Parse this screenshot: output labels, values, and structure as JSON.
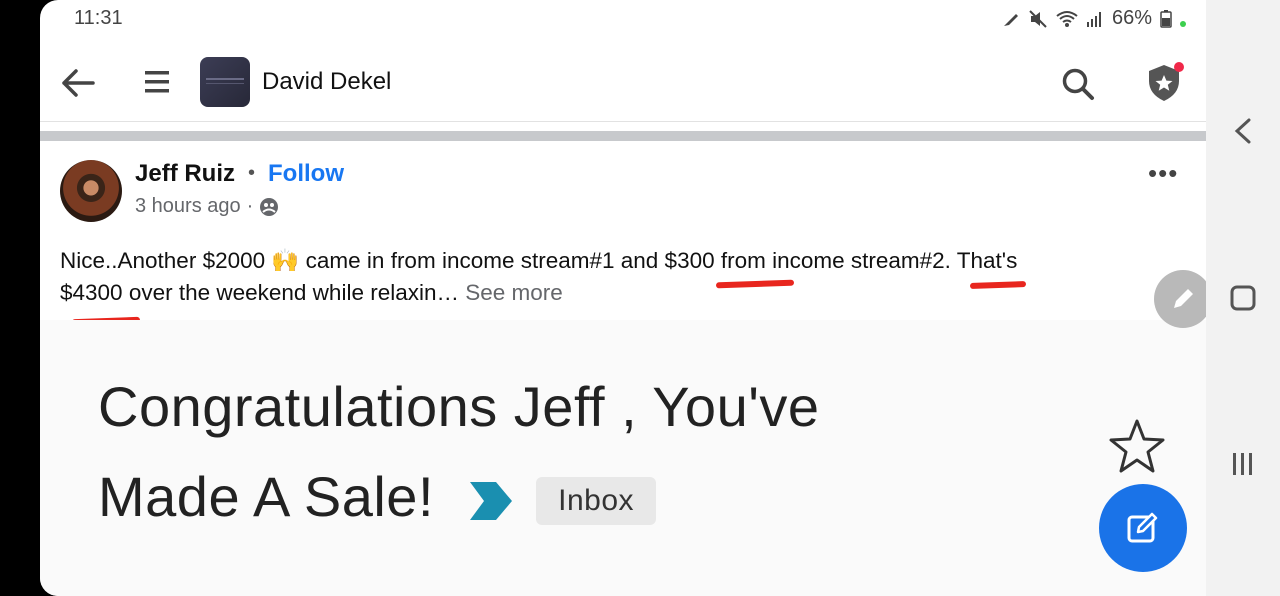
{
  "status_bar": {
    "time": "11:31",
    "battery": "66%"
  },
  "header": {
    "group_name": "David Dekel"
  },
  "post": {
    "author": "Jeff Ruiz",
    "follow_label": "Follow",
    "time": "3 hours ago",
    "dot": "·",
    "text_line1": "Nice..Another $2000 🙌 came in from income stream#1 and $300 from income stream#2. That's",
    "text_line2": "$4300 over the weekend  while relaxin…",
    "see_more": "See more"
  },
  "attachment": {
    "line1": "Congratulations Jeff , You've",
    "line2": "Made A Sale!",
    "tag": "Inbox"
  },
  "colors": {
    "accent": "#1877f2",
    "annotation": "#e8261e",
    "compose_fab": "#1a73e8"
  }
}
